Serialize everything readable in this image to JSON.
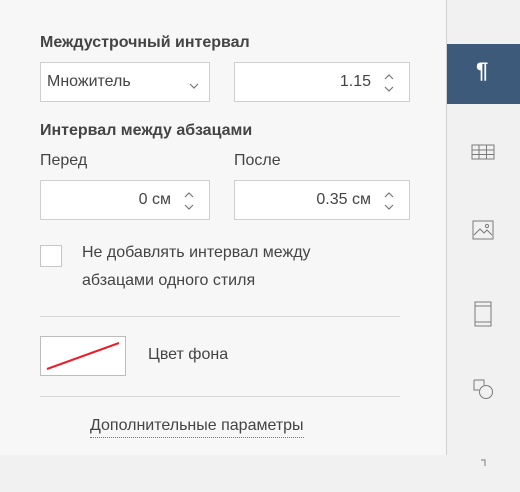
{
  "line_spacing": {
    "heading": "Междустрочный интервал",
    "mode": "Множитель",
    "value": "1.15"
  },
  "paragraph_spacing": {
    "heading": "Интервал между абзацами",
    "before_label": "Перед",
    "after_label": "После",
    "before_value": "0 см",
    "after_value": "0.35 см"
  },
  "no_space_option": {
    "line1": "Не добавлять интервал между",
    "line2": "абзацами одного стиля",
    "checked": false
  },
  "background": {
    "label": "Цвет фона",
    "color": "none"
  },
  "advanced_link": "Дополнительные параметры",
  "sidebar": {
    "active": "paragraph-settings",
    "items": [
      "paragraph-settings",
      "table-settings",
      "image-settings",
      "header-footer-settings",
      "shape-settings",
      "signature-settings"
    ]
  },
  "colors": {
    "accent": "#3e5a7b",
    "no_fill_line": "#e8202a"
  }
}
